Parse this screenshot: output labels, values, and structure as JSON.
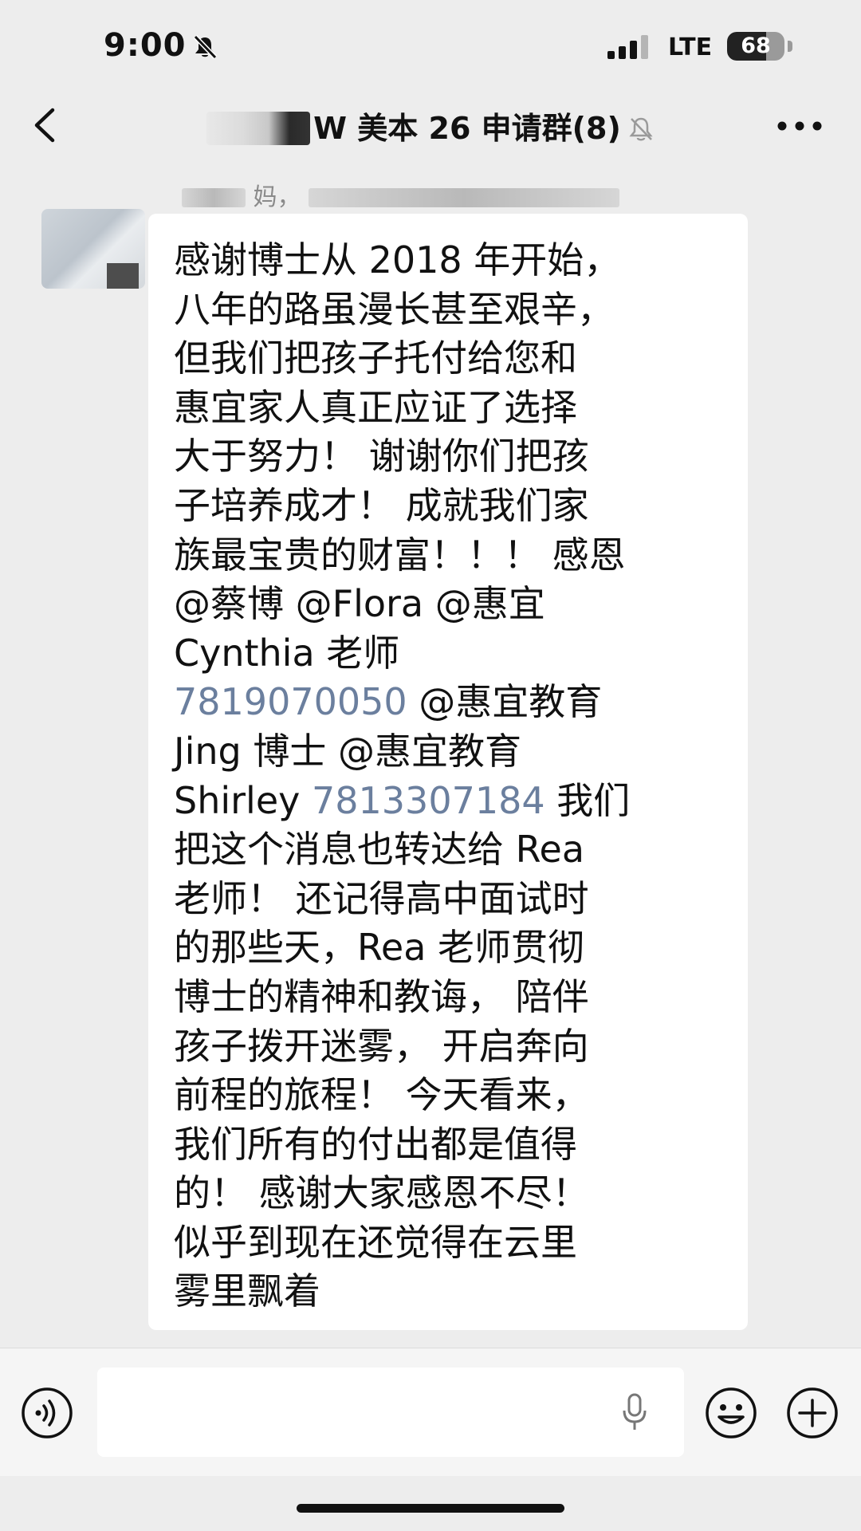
{
  "status_bar": {
    "time": "9:00",
    "network": "LTE",
    "battery_percent": "68",
    "battery_level": 0.68
  },
  "header": {
    "title": "W 美本 26 申请群(8)",
    "icons": [
      "back-icon",
      "mute-bell-icon",
      "more-icon"
    ]
  },
  "message": {
    "sender_name_visible": "妈，",
    "lines": [
      [
        {
          "t": "感谢博士从 2018 年开始，"
        }
      ],
      [
        {
          "t": "八年的路虽漫长甚至艰辛，"
        }
      ],
      [
        {
          "t": "但我们把孩子托付给您和"
        }
      ],
      [
        {
          "t": "惠宜家人真正应证了选择"
        }
      ],
      [
        {
          "t": "大于努力！ 谢谢你们把孩"
        }
      ],
      [
        {
          "t": "子培养成才！ 成就我们家"
        }
      ],
      [
        {
          "t": "族最宝贵的财富！！！ 感恩"
        }
      ],
      [
        {
          "t": "@蔡博 @Flora @惠宜"
        }
      ],
      [
        {
          "t": "Cynthia 老师"
        }
      ],
      [
        {
          "t": "7819070050",
          "phone": true
        },
        {
          "t": " @惠宜教育"
        }
      ],
      [
        {
          "t": "Jing 博士 @惠宜教育"
        }
      ],
      [
        {
          "t": "Shirley "
        },
        {
          "t": "7813307184",
          "phone": true
        },
        {
          "t": " 我们"
        }
      ],
      [
        {
          "t": "把这个消息也转达给 Rea"
        }
      ],
      [
        {
          "t": "老师！ 还记得高中面试时"
        }
      ],
      [
        {
          "t": "的那些天，Rea 老师贯彻"
        }
      ],
      [
        {
          "t": "博士的精神和教诲， 陪伴"
        }
      ],
      [
        {
          "t": "孩子拨开迷雾， 开启奔向"
        }
      ],
      [
        {
          "t": "前程的旅程！ 今天看来，"
        }
      ],
      [
        {
          "t": "我们所有的付出都是值得"
        }
      ],
      [
        {
          "t": "的！ 感谢大家感恩不尽！"
        }
      ],
      [
        {
          "t": "似乎到现在还觉得在云里"
        }
      ],
      [
        {
          "t": "雾里飘着"
        }
      ]
    ]
  },
  "input_bar": {
    "text_value": "",
    "icons": [
      "voice-icon",
      "mic-icon",
      "emoji-icon",
      "plus-icon"
    ]
  },
  "colors": {
    "background": "#ededed",
    "bubble": "#ffffff",
    "phone_link": "#6b7f9e",
    "text": "#111111"
  }
}
